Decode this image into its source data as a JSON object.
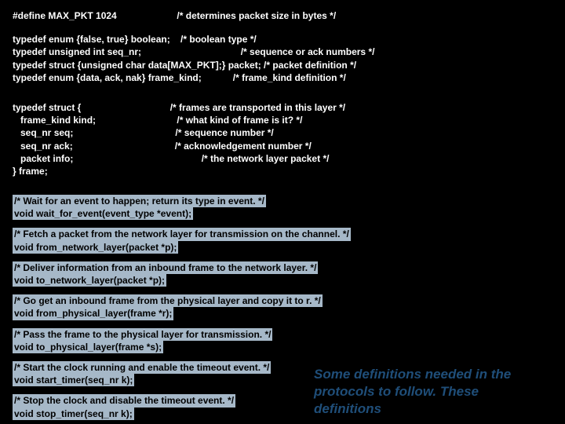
{
  "defs": {
    "l1": "#define MAX_PKT 1024                       /* determines packet size in bytes */",
    "l2": "typedef enum {false, true} boolean;    /* boolean type */",
    "l3": "typedef unsigned int seq_nr;                                      /* sequence or ack numbers */",
    "l4": "typedef struct {unsigned char data[MAX_PKT];} packet; /* packet definition */",
    "l5": "typedef enum {data, ack, nak} frame_kind;            /* frame_kind definition */"
  },
  "struct": {
    "s1": "typedef struct {                                  /* frames are transported in this layer */",
    "s2": "   frame_kind kind;                               /* what kind of frame is it? */",
    "s3": "   seq_nr seq;                                       /* sequence number */",
    "s4": "   seq_nr ack;                                       /* acknowledgement number */",
    "s5": "   packet info;                                                 /* the network layer packet */",
    "s6": "} frame;"
  },
  "fn": {
    "c1": "/* Wait for an event to happen; return its type in event. */",
    "f1": "void wait_for_event(event_type *event);",
    "c2": "/* Fetch a packet from the network layer for transmission on the channel. */",
    "f2": "void from_network_layer(packet *p);",
    "c3": "/* Deliver information from an inbound frame to the network layer. */",
    "f3": "void to_network_layer(packet *p);",
    "c4": "/* Go get an inbound frame from the physical layer and copy it to r. */",
    "f4": "void from_physical_layer(frame *r);",
    "c5": "/* Pass the frame to the physical layer for transmission. */",
    "f5": "void to_physical_layer(frame *s);",
    "c6": "/* Start the clock running and enable the timeout event. */",
    "f6": "void start_timer(seq_nr k);",
    "c7": "/* Stop the clock and disable the timeout event. */",
    "f7": "void stop_timer(seq_nr k);"
  },
  "note": "Some definitions needed in the protocols to follow. These definitions"
}
